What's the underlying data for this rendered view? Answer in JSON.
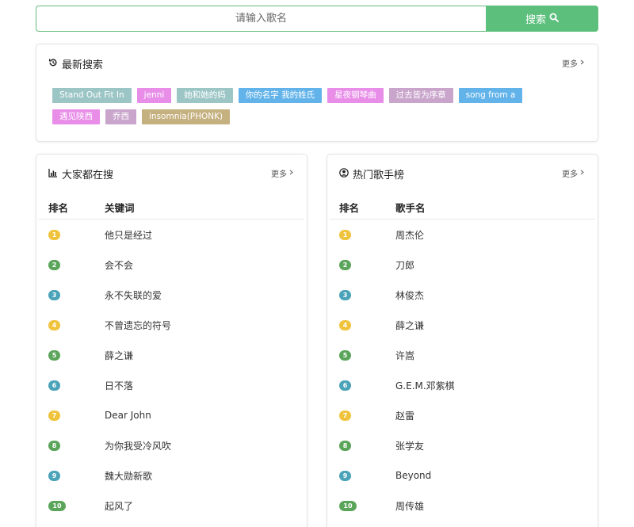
{
  "search": {
    "placeholder": "请输入歌名",
    "button_label": "搜索"
  },
  "recent": {
    "title": "最新搜索",
    "more_label": "更多",
    "tags": [
      {
        "label": "Stand Out Fit In",
        "color": "#9cc5c5"
      },
      {
        "label": "jenni",
        "color": "#e88ee8"
      },
      {
        "label": "她和她的妈",
        "color": "#9cc5c5"
      },
      {
        "label": "你的名字 我的姓氏",
        "color": "#62b3ea"
      },
      {
        "label": "星夜钢琴曲",
        "color": "#e88ee8"
      },
      {
        "label": "过去皆为序章",
        "color": "#c9a5cc"
      },
      {
        "label": "song from a",
        "color": "#62b3ea"
      },
      {
        "label": "遇见陕西",
        "color": "#e88ee8"
      },
      {
        "label": "乔西",
        "color": "#c9a5cc"
      },
      {
        "label": "insomnia(PHONK)",
        "color": "#c5b07f"
      }
    ]
  },
  "hot_search": {
    "title": "大家都在搜",
    "more_label": "更多",
    "col_rank": "排名",
    "col_name": "关键词",
    "rows": [
      {
        "rank": "1",
        "name": "他只是经过",
        "color": "#f0c33c"
      },
      {
        "rank": "2",
        "name": "会不会",
        "color": "#5aa55a"
      },
      {
        "rank": "3",
        "name": "永不失联的爱",
        "color": "#4aa3b8"
      },
      {
        "rank": "4",
        "name": "不曾遗忘的符号",
        "color": "#f0c33c"
      },
      {
        "rank": "5",
        "name": "薛之谦",
        "color": "#5aa55a"
      },
      {
        "rank": "6",
        "name": "日不落",
        "color": "#4aa3b8"
      },
      {
        "rank": "7",
        "name": "Dear John",
        "color": "#f0c33c"
      },
      {
        "rank": "8",
        "name": "为你我受冷风吹",
        "color": "#5aa55a"
      },
      {
        "rank": "9",
        "name": "魏大勋新歌",
        "color": "#4aa3b8"
      },
      {
        "rank": "10",
        "name": "起风了",
        "color": "#5aa55a"
      }
    ]
  },
  "hot_singer": {
    "title": "热门歌手榜",
    "more_label": "更多",
    "col_rank": "排名",
    "col_name": "歌手名",
    "rows": [
      {
        "rank": "1",
        "name": "周杰伦",
        "color": "#f0c33c"
      },
      {
        "rank": "2",
        "name": "刀郎",
        "color": "#5aa55a"
      },
      {
        "rank": "3",
        "name": "林俊杰",
        "color": "#4aa3b8"
      },
      {
        "rank": "4",
        "name": "薛之谦",
        "color": "#f0c33c"
      },
      {
        "rank": "5",
        "name": "许嵩",
        "color": "#5aa55a"
      },
      {
        "rank": "6",
        "name": "G.E.M.邓紫棋",
        "color": "#4aa3b8"
      },
      {
        "rank": "7",
        "name": "赵雷",
        "color": "#f0c33c"
      },
      {
        "rank": "8",
        "name": "张学友",
        "color": "#5aa55a"
      },
      {
        "rank": "9",
        "name": "Beyond",
        "color": "#4aa3b8"
      },
      {
        "rank": "10",
        "name": "周传雄",
        "color": "#5aa55a"
      }
    ]
  },
  "icons": {
    "search_button": "search-icon",
    "recent": "history-icon",
    "hot_search": "bar-chart-icon",
    "hot_singer": "user-circle-icon",
    "more": "chevron-right-icon"
  }
}
